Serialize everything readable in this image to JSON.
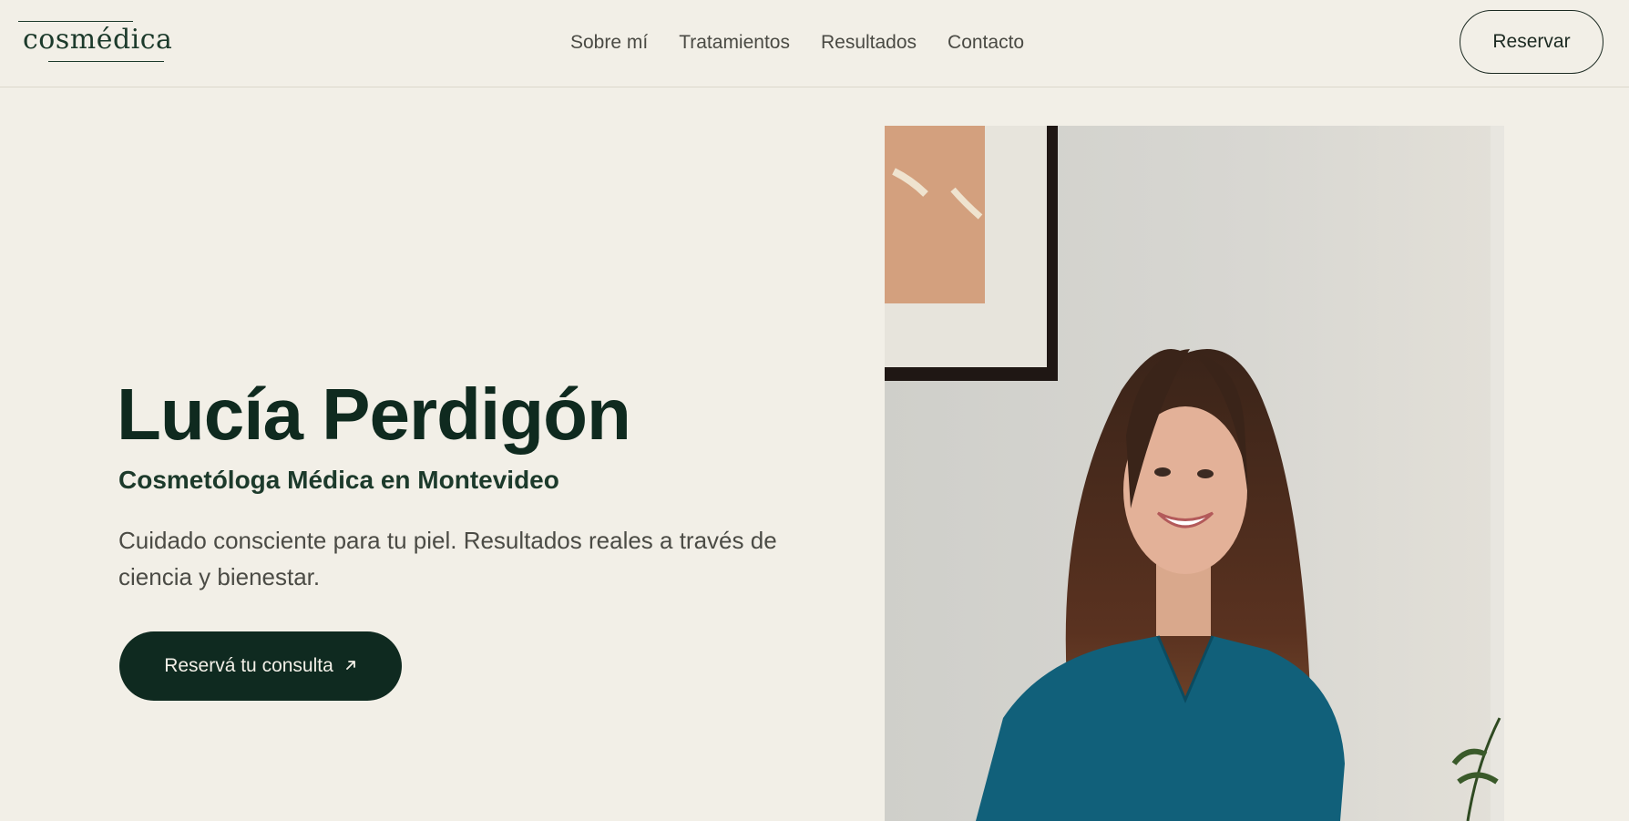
{
  "header": {
    "logo_text": "cosmédica",
    "nav": [
      {
        "label": "Sobre mí"
      },
      {
        "label": "Tratamientos"
      },
      {
        "label": "Resultados"
      },
      {
        "label": "Contacto"
      }
    ],
    "cta_label": "Reservar"
  },
  "hero": {
    "name": "Lucía Perdigón",
    "subtitle": "Cosmetóloga Médica en Montevideo",
    "description": "Cuidado consciente para tu piel. Resultados reales a través de ciencia y bienestar.",
    "cta_label": "Reservá tu consulta",
    "cta_icon": "arrow-up-right-icon"
  },
  "colors": {
    "background": "#f2efe7",
    "accent_dark_green": "#0f2a20",
    "text_muted": "#4b4b45"
  }
}
